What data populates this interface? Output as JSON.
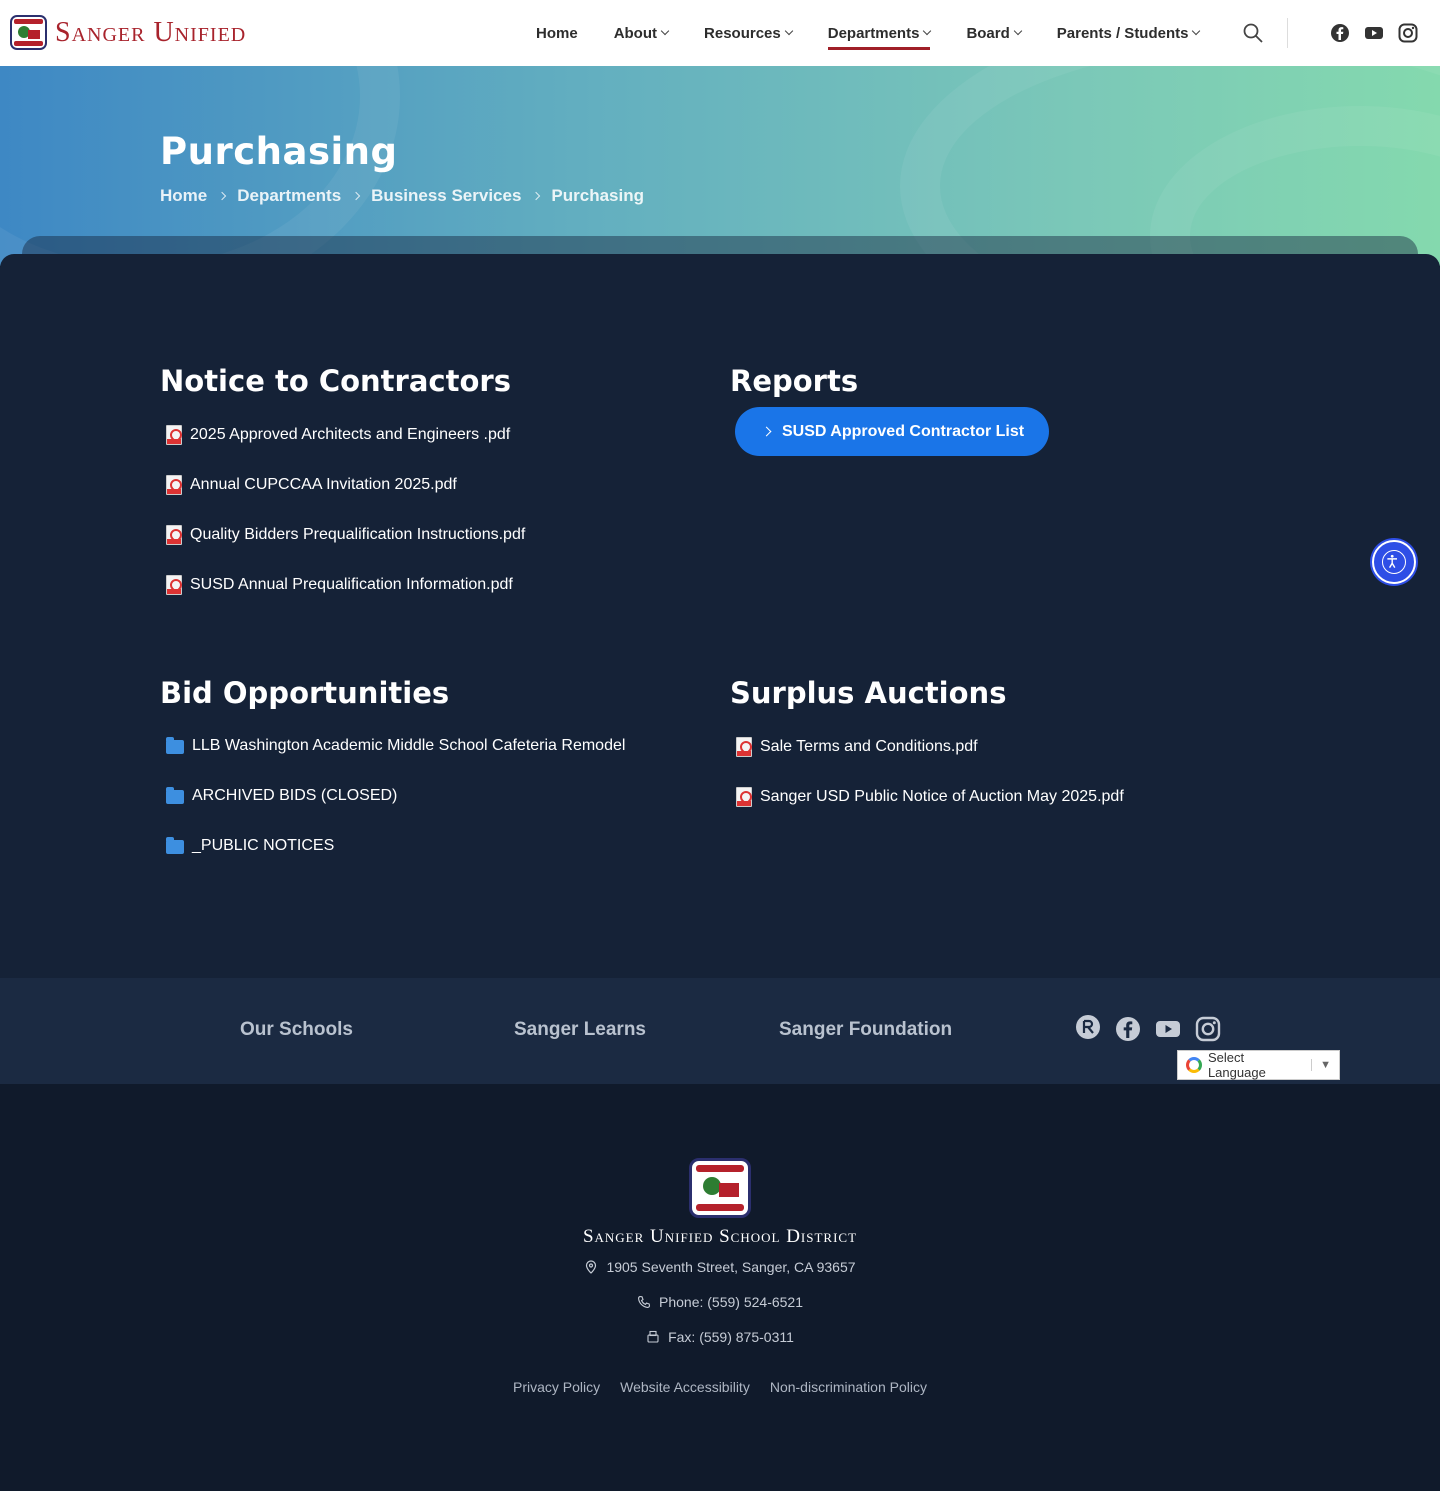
{
  "header": {
    "logo_text": "Sanger Unified",
    "nav": [
      {
        "label": "Home",
        "dropdown": false
      },
      {
        "label": "About",
        "dropdown": true
      },
      {
        "label": "Resources",
        "dropdown": true
      },
      {
        "label": "Departments",
        "dropdown": true,
        "active": true
      },
      {
        "label": "Board",
        "dropdown": true
      },
      {
        "label": "Parents / Students",
        "dropdown": true
      }
    ],
    "icons": [
      "search-icon",
      "facebook-icon",
      "youtube-icon",
      "instagram-icon"
    ]
  },
  "hero": {
    "title": "Purchasing",
    "breadcrumb": [
      "Home",
      "Departments",
      "Business Services",
      "Purchasing"
    ]
  },
  "sections": {
    "notice": {
      "title": "Notice to Contractors",
      "files": [
        "2025 Approved Architects and Engineers .pdf",
        "Annual CUPCCAA Invitation 2025.pdf",
        "Quality Bidders Prequalification Instructions.pdf",
        "SUSD Annual Prequalification Information.pdf"
      ]
    },
    "reports": {
      "title": "Reports",
      "button": "SUSD Approved Contractor List"
    },
    "bids": {
      "title": "Bid Opportunities",
      "folders": [
        "LLB Washington Academic Middle School Cafeteria Remodel",
        "ARCHIVED BIDS (CLOSED)",
        "_PUBLIC NOTICES"
      ]
    },
    "surplus": {
      "title": "Surplus Auctions",
      "files": [
        "Sale Terms and Conditions.pdf",
        "Sanger USD Public Notice of Auction May 2025.pdf"
      ]
    }
  },
  "footer_links": [
    "Our Schools",
    "Sanger Learns",
    "Sanger Foundation"
  ],
  "language": {
    "label": "Select Language"
  },
  "footer": {
    "district": "Sanger Unified School District",
    "address": "1905 Seventh Street, Sanger, CA 93657",
    "phone": "Phone: (559) 524-6521",
    "fax": "Fax: (559) 875-0311",
    "policies": [
      "Privacy Policy",
      "Website Accessibility",
      "Non-discrimination Policy"
    ]
  },
  "colors": {
    "accent": "#a01f28",
    "button": "#1a75e8",
    "main_bg": "#152237",
    "footer_bg": "#101a2b"
  }
}
